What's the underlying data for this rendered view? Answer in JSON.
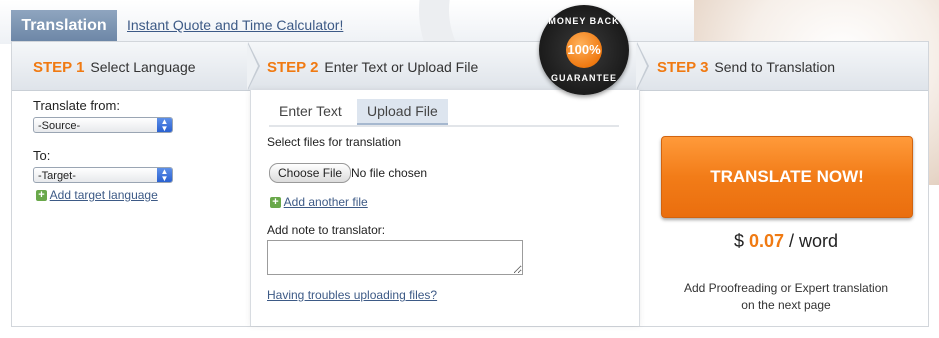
{
  "header": {
    "title": "Translation",
    "quote_link": "Instant Quote and Time Calculator!"
  },
  "steps": [
    {
      "num": "STEP 1",
      "label": "Select Language"
    },
    {
      "num": "STEP 2",
      "label": "Enter Text or Upload File"
    },
    {
      "num": "STEP 3",
      "label": "Send to Translation"
    }
  ],
  "step1": {
    "from_label": "Translate from:",
    "from_select": "-Source-",
    "to_label": "To:",
    "to_select": "-Target-",
    "add_target": "Add target language"
  },
  "step2": {
    "tabs": [
      "Enter Text",
      "Upload File"
    ],
    "active_tab": "Upload File",
    "select_files_label": "Select files for translation",
    "choose_file_button": "Choose File",
    "no_file_text": "No file chosen",
    "add_another": "Add another file",
    "note_label": "Add note to translator:",
    "note_value": "",
    "trouble_link": "Having troubles uploading files?"
  },
  "badge": {
    "top": "MONEY BACK",
    "center": "100%",
    "bottom": "GUARANTEE"
  },
  "step3": {
    "button": "TRANSLATE NOW!",
    "currency": "$",
    "price": "0.07",
    "unit": "/ word",
    "note_line1": "Add Proofreading or Expert translation",
    "note_line2": "on the next page"
  },
  "colors": {
    "accent": "#f07a12",
    "link": "#3d5a86",
    "tab_header": "#7a92b0"
  }
}
